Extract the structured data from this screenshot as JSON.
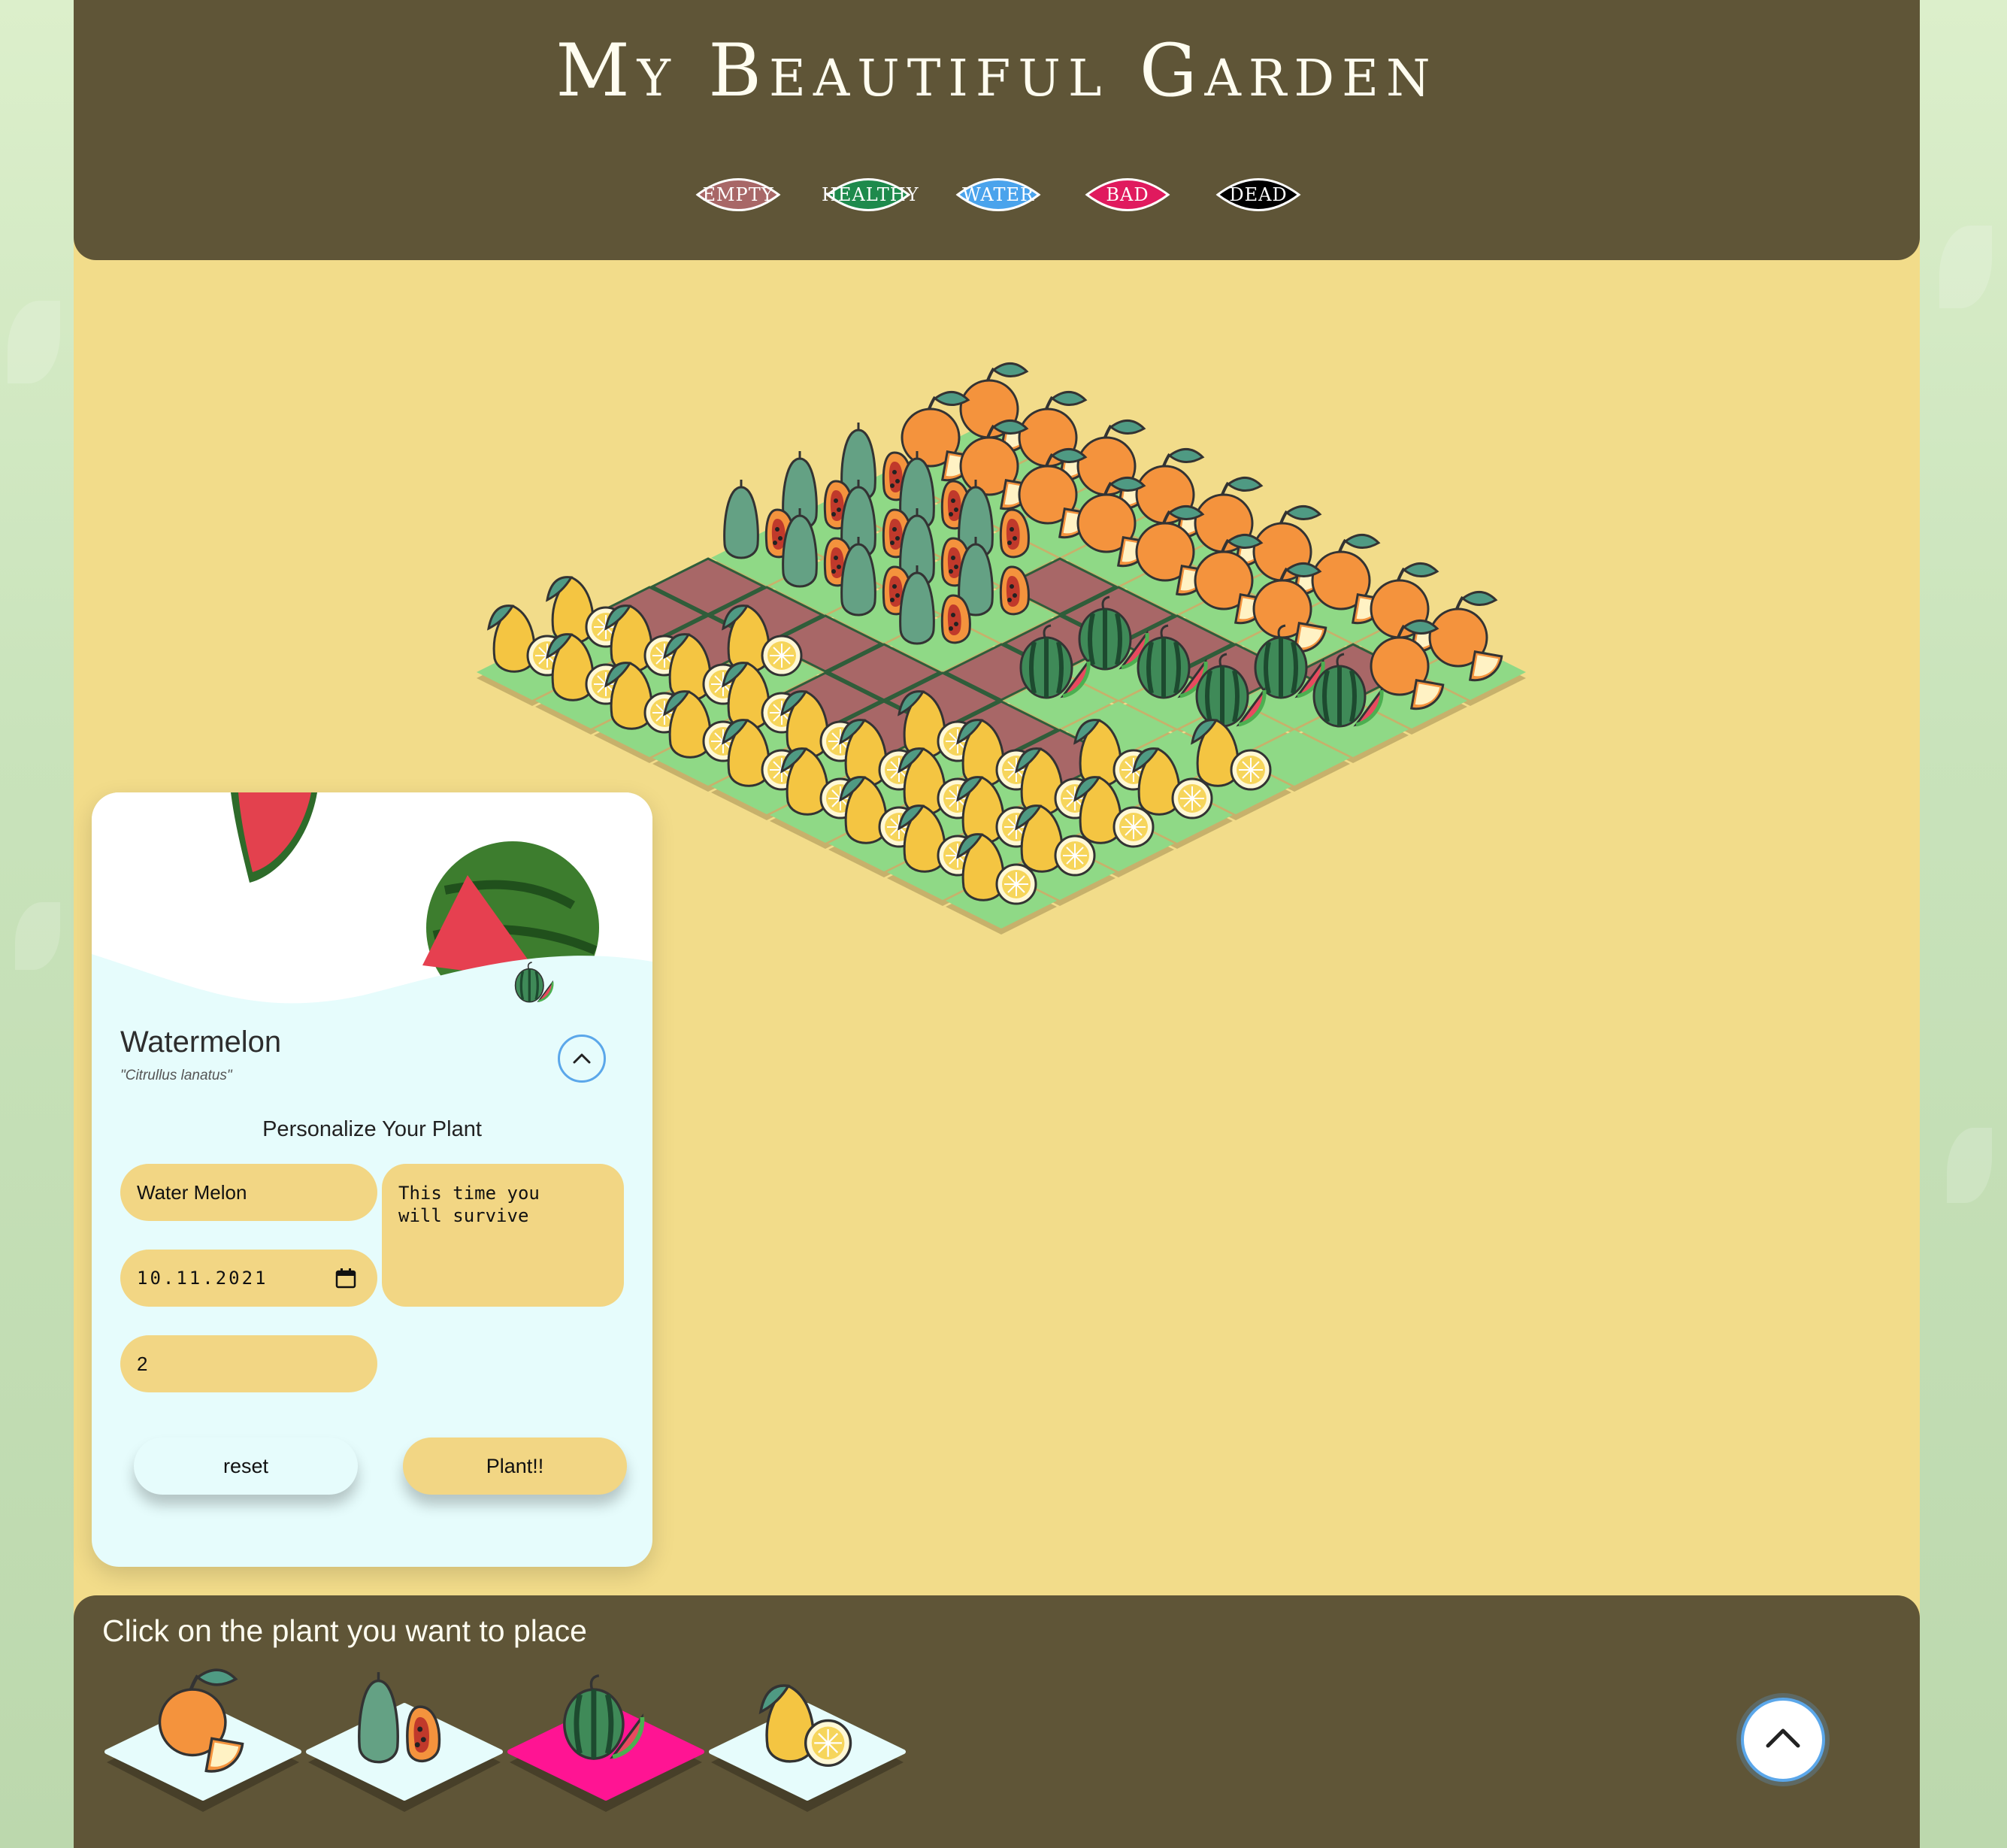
{
  "header": {
    "title": "My Beautiful Garden"
  },
  "legend": [
    {
      "label": "EMPTY",
      "color": "#a86767"
    },
    {
      "label": "HEALTHY",
      "color": "#1e8a4c"
    },
    {
      "label": "WATER",
      "color": "#4aa3ec"
    },
    {
      "label": "BAD",
      "color": "#e01a5e"
    },
    {
      "label": "DEAD",
      "color": "#000000"
    }
  ],
  "plants": {
    "orange": {
      "icon": "orange-icon"
    },
    "papaya": {
      "icon": "papaya-icon"
    },
    "watermelon": {
      "icon": "watermelon-icon"
    },
    "lemon": {
      "icon": "lemon-icon"
    }
  },
  "garden": {
    "tile_colors": {
      "soil": "#a86767",
      "grass": "#8fd986"
    },
    "grid": [
      [
        "orange",
        "orange",
        "orange",
        "orange",
        "orange",
        "orange",
        "orange",
        "orange",
        "orange"
      ],
      [
        "orange",
        "orange",
        "orange",
        "orange",
        "orange",
        "orange",
        "orange",
        "soil",
        "orange"
      ],
      [
        "papaya",
        "papaya",
        "papaya",
        "soil",
        "soil",
        "soil",
        "soil",
        "watermelon",
        "watermelon"
      ],
      [
        "papaya",
        "papaya",
        "papaya",
        "papaya",
        "soil",
        "watermelon",
        "watermelon",
        "watermelon",
        "grass"
      ],
      [
        "papaya",
        "papaya",
        "papaya",
        "papaya",
        "soil",
        "watermelon",
        "grass",
        "grass",
        "lemon"
      ],
      [
        "soil",
        "soil",
        "soil",
        "soil",
        "soil",
        "soil",
        "soil",
        "lemon",
        "lemon"
      ],
      [
        "soil",
        "soil",
        "lemon",
        "soil",
        "soil",
        "lemon",
        "lemon",
        "lemon",
        "lemon"
      ],
      [
        "lemon",
        "lemon",
        "lemon",
        "lemon",
        "lemon",
        "lemon",
        "lemon",
        "lemon",
        "lemon"
      ],
      [
        "lemon",
        "lemon",
        "lemon",
        "lemon",
        "lemon",
        "lemon",
        "lemon",
        "lemon",
        "lemon"
      ]
    ]
  },
  "card": {
    "name": "Watermelon",
    "scientific": "\"Citrullus lanatus\"",
    "icon": "watermelon-icon",
    "section_title": "Personalize Your Plant",
    "name_value": "Water Melon",
    "date_value": "10.11.2021",
    "count_value": "2",
    "note_value": "This time you\nwill survive",
    "reset_label": "reset",
    "plant_label": "Plant!!"
  },
  "footer": {
    "instruction": "Click on the plant you want to place",
    "options": [
      {
        "plant": "orange",
        "selected": false
      },
      {
        "plant": "papaya",
        "selected": false
      },
      {
        "plant": "watermelon",
        "selected": true
      },
      {
        "plant": "lemon",
        "selected": false
      }
    ],
    "selected_color": "#ff1493"
  }
}
